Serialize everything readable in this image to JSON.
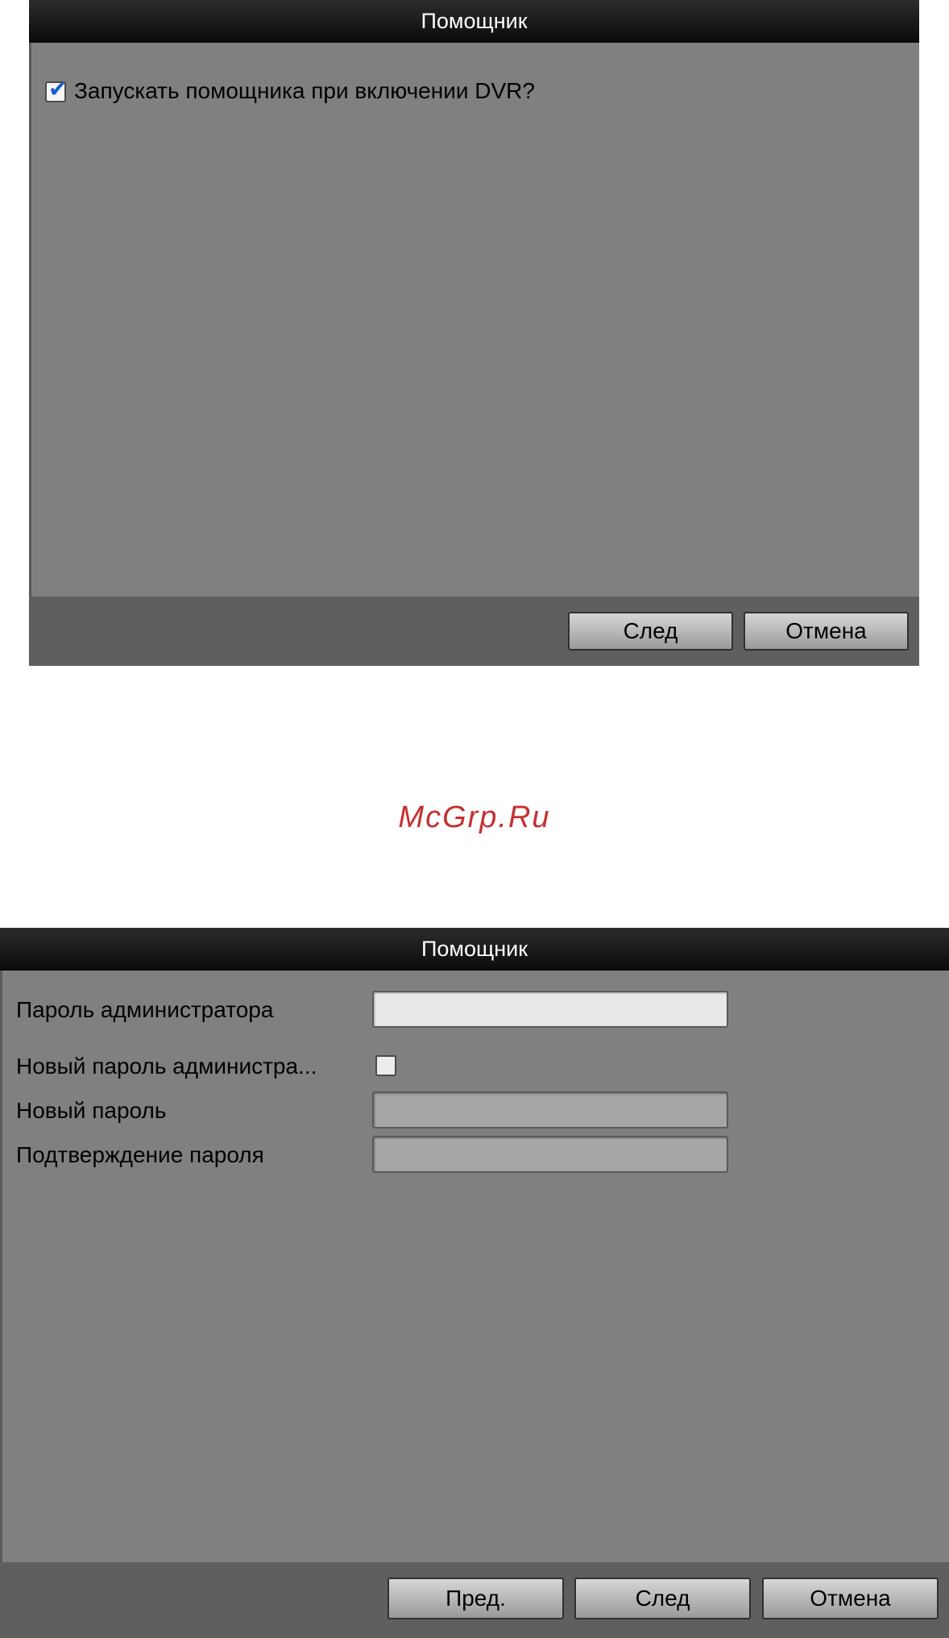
{
  "dialog1": {
    "title": "Помощник",
    "startup_checkbox": {
      "label": "Запускать помощника при включении DVR?",
      "checked": true
    },
    "next_button": "След",
    "cancel_button": "Отмена"
  },
  "watermark": {
    "text": "McGrp.Ru"
  },
  "dialog2": {
    "title": "Помощник",
    "admin_password": {
      "label": "Пароль администратора",
      "value": ""
    },
    "new_admin_password": {
      "label": "Новый пароль администра...",
      "checked": false
    },
    "new_password": {
      "label": "Новый пароль",
      "value": ""
    },
    "confirm_password": {
      "label": "Подтверждение пароля",
      "value": ""
    },
    "prev_button": "Пред.",
    "next_button": "След",
    "cancel_button": "Отмена"
  },
  "colors": {
    "dialog_bg": "#808080",
    "footer_bg": "#5f5f5f",
    "title_bg": "#111111",
    "field_enabled": "#e8e8e8",
    "field_disabled": "#a6a6a6",
    "watermark": "#c43030"
  }
}
